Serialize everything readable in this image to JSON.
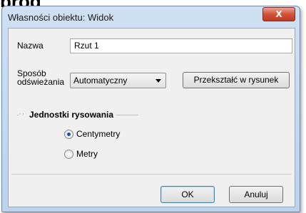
{
  "page": {
    "heading_fragment": "prog"
  },
  "window": {
    "title": "Własności obiektu: Widok",
    "close_glyph": "X"
  },
  "form": {
    "name_label": "Nazwa",
    "name_value": "Rzut 1",
    "refresh_label_line1": "Sposób",
    "refresh_label_line2": "odświeżania",
    "refresh_selected": "Automatyczny",
    "convert_button": "Przekształć w rysunek"
  },
  "units": {
    "group_title": "Jednostki rysowania",
    "options": [
      {
        "label": "Centymetry",
        "checked": true
      },
      {
        "label": "Metry",
        "checked": false
      }
    ]
  },
  "footer": {
    "ok": "OK",
    "cancel": "Anuluj"
  }
}
